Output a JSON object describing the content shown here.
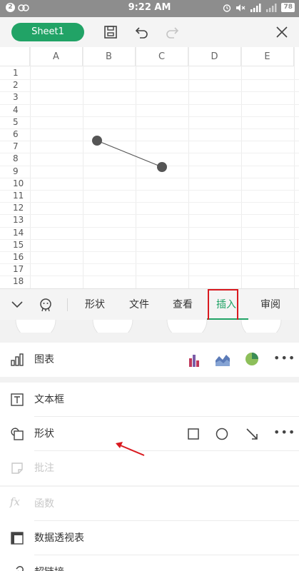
{
  "status_bar": {
    "notif_badge": "2",
    "time": "9:22 AM",
    "battery": "78"
  },
  "toolbar": {
    "sheet_name": "Sheet1"
  },
  "grid": {
    "columns": [
      "A",
      "B",
      "C",
      "D",
      "E"
    ],
    "rows": [
      "1",
      "2",
      "3",
      "4",
      "5",
      "6",
      "7",
      "8",
      "9",
      "10",
      "11",
      "12",
      "13",
      "14",
      "15",
      "16",
      "17",
      "18"
    ]
  },
  "tabs": [
    {
      "label": "形状"
    },
    {
      "label": "文件"
    },
    {
      "label": "查看"
    },
    {
      "label": "插入"
    },
    {
      "label": "审阅"
    }
  ],
  "panel": {
    "chart": "图表",
    "textbox": "文本框",
    "shape": "形状",
    "comment": "批注",
    "function": "函数",
    "pivot": "数据透视表",
    "hyperlink": "超链接"
  },
  "colors": {
    "accent": "#21a366",
    "highlight": "#d9191f"
  }
}
